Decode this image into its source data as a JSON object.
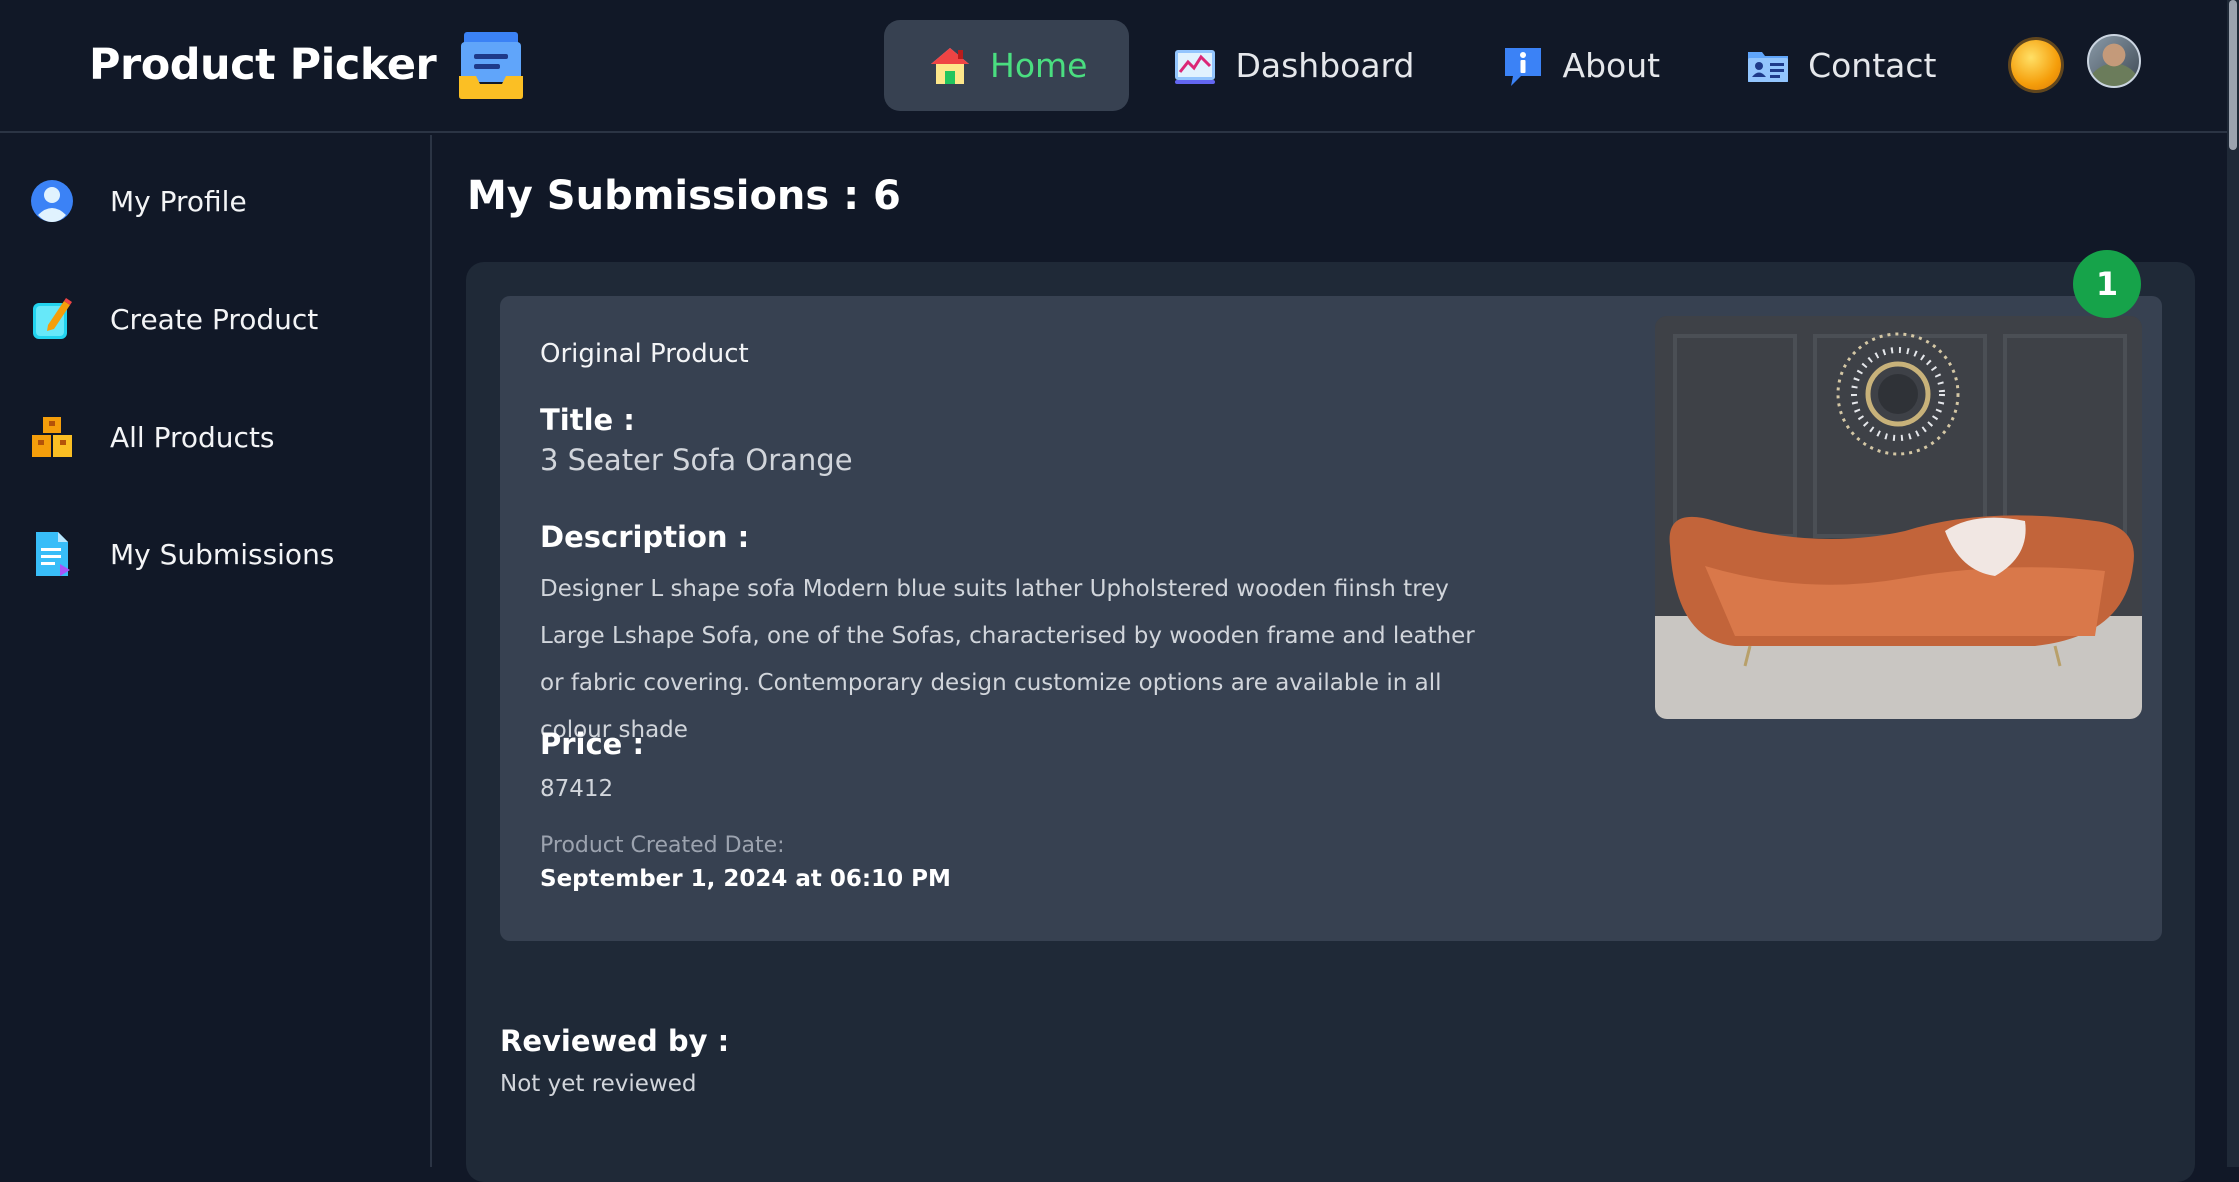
{
  "app": {
    "title": "Product Picker"
  },
  "nav": {
    "items": [
      {
        "label": "Home",
        "icon": "house-icon",
        "active": true
      },
      {
        "label": "Dashboard",
        "icon": "chart-icon",
        "active": false
      },
      {
        "label": "About",
        "icon": "info-icon",
        "active": false
      },
      {
        "label": "Contact",
        "icon": "contact-card-icon",
        "active": false
      }
    ]
  },
  "sidebar": {
    "items": [
      {
        "label": "My Profile",
        "icon": "user-icon"
      },
      {
        "label": "Create Product",
        "icon": "edit-icon"
      },
      {
        "label": "All Products",
        "icon": "boxes-icon"
      },
      {
        "label": "My Submissions",
        "icon": "document-icon"
      }
    ]
  },
  "main": {
    "heading": "My Submissions : 6",
    "submission": {
      "badge": "1",
      "section_label": "Original Product",
      "title_label": "Title :",
      "title": "3 Seater Sofa Orange",
      "description_label": "Description :",
      "description": "Designer L shape sofa Modern blue suits lather Upholstered wooden fiinsh trey Large Lshape Sofa, one of the Sofas, characterised by wooden frame and leather or fabric covering. Contemporary design customize options are available in all colour shade",
      "price_label": "Price :",
      "price": "87412",
      "created_label": "Product Created Date:",
      "created_date": "September 1, 2024 at 06:10 PM",
      "image_alt": "sofa-photo"
    },
    "review": {
      "label": "Reviewed by :",
      "value": "Not yet reviewed"
    }
  },
  "colors": {
    "background": "#111827",
    "card": "#1f2937",
    "inner_card": "#374151",
    "accent_green": "#4ade80",
    "badge_green": "#16a34a"
  }
}
